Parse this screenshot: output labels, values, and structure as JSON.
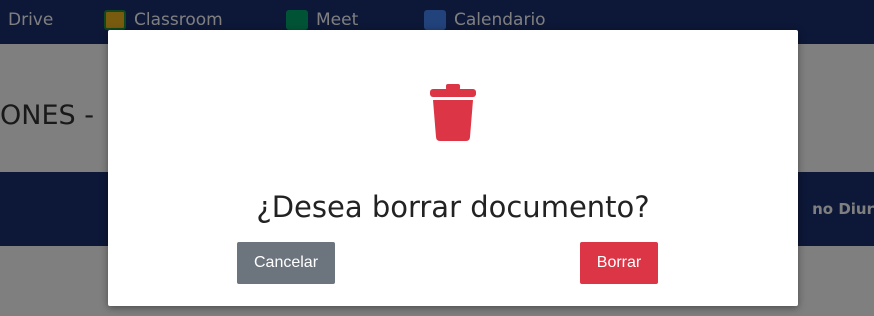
{
  "nav": {
    "drive": "Drive",
    "classroom": "Classroom",
    "meet": "Meet",
    "calendar": "Calendario"
  },
  "page": {
    "title_fragment": "ONES -",
    "band_text_fragment": "no Diur"
  },
  "modal": {
    "icon": "trash-icon",
    "question": "¿Desea borrar documento?",
    "cancel_label": "Cancelar",
    "delete_label": "Borrar"
  },
  "colors": {
    "nav_bg": "#1b2f6e",
    "danger": "#dc3545",
    "secondary": "#6c757d"
  }
}
